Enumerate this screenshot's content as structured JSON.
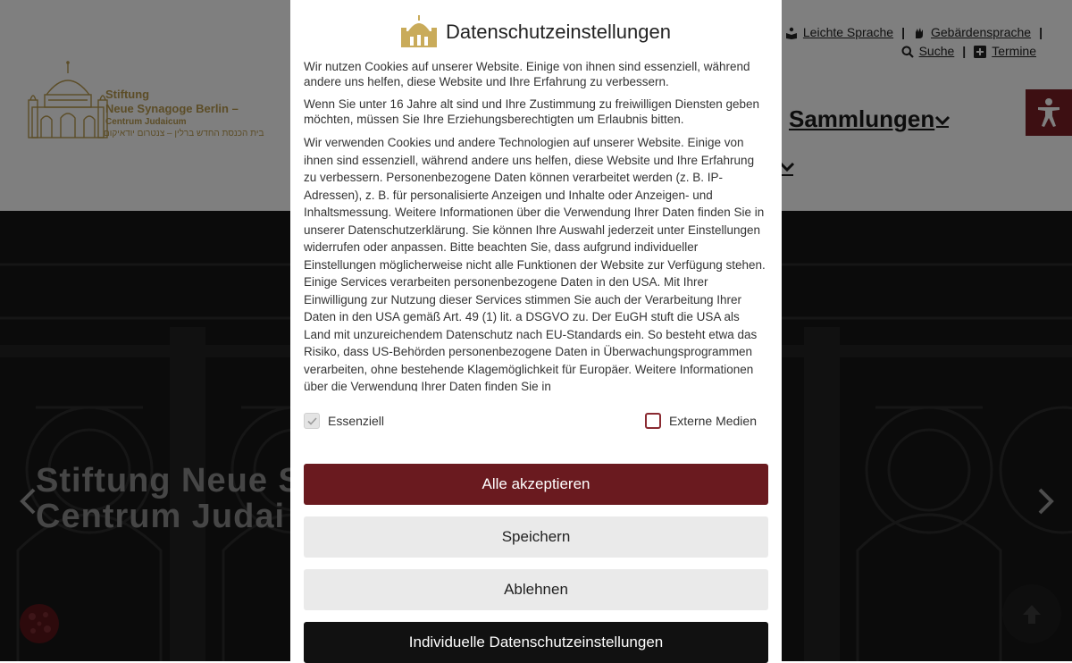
{
  "header": {
    "logo": {
      "line1": "Stiftung",
      "line2": "Neue Synagoge Berlin –",
      "line3": "Centrum Judaicum",
      "line4": "בית הכנסת החדש ברלין – צנטרום יודאיקום"
    },
    "topnav": {
      "row1": [
        "Leichte Sprache",
        "Gebärdensprache"
      ],
      "row2": [
        "Suche",
        "Termine"
      ]
    },
    "mainnav": {
      "item": "Sammlungen"
    }
  },
  "hero": {
    "title_line1": "Stiftung Neue S",
    "title_line2": "Centrum Judai"
  },
  "modal": {
    "title": "Datenschutzeinstellungen",
    "paragraphs": [
      "Wir nutzen Cookies auf unserer Website. Einige von ihnen sind essenziell, während andere uns helfen, diese Website und Ihre Erfahrung zu verbessern.",
      "Wenn Sie unter 16 Jahre alt sind und Ihre Zustimmung zu freiwilligen Diensten geben möchten, müssen Sie Ihre Erziehungsberechtigten um Erlaubnis bitten.",
      "Wir verwenden Cookies und andere Technologien auf unserer Website. Einige von ihnen sind essenziell, während andere uns helfen, diese Website und Ihre Erfahrung zu verbessern. Personenbezogene Daten können verarbeitet werden (z. B. IP-Adressen), z. B. für personalisierte Anzeigen und Inhalte oder Anzeigen- und Inhaltsmessung. Weitere Informationen über die Verwendung Ihrer Daten finden Sie in unserer Datenschutzerklärung. Sie können Ihre Auswahl jederzeit unter Einstellungen widerrufen oder anpassen. Bitte beachten Sie, dass aufgrund individueller Einstellungen möglicherweise nicht alle Funktionen der Website zur Verfügung stehen. Einige Services verarbeiten personenbezogene Daten in den USA. Mit Ihrer Einwilligung zur Nutzung dieser Services stimmen Sie auch der Verarbeitung Ihrer Daten in den USA gemäß Art. 49 (1) lit. a DSGVO zu. Der EuGH stuft die USA als Land mit unzureichendem Datenschutz nach EU-Standards ein. So besteht etwa das Risiko, dass US-Behörden personenbezogene Daten in Überwachungsprogrammen verarbeiten, ohne bestehende Klagemöglichkeit für Europäer. Weitere Informationen über die Verwendung Ihrer Daten finden Sie in"
    ],
    "checks": {
      "essential": {
        "label": "Essenziell",
        "checked": true
      },
      "external": {
        "label": "Externe Medien",
        "checked": false
      }
    },
    "buttons": {
      "accept_all": "Alle akzeptieren",
      "save": "Speichern",
      "reject": "Ablehnen",
      "individual": "Individuelle Datenschutzeinstellungen"
    }
  },
  "colors": {
    "brand_red": "#6a1a1f",
    "gold": "#b99a4e",
    "dark_button": "#111111",
    "light_button": "#eaeaea"
  },
  "icons": [
    "synagogue-logo-icon",
    "book-reading-icon",
    "sign-language-icon",
    "search-icon",
    "plus-square-icon",
    "chevron-down-icon",
    "accessibility-icon",
    "chevron-left-icon",
    "chevron-right-icon",
    "arrow-up-icon",
    "cookie-icon",
    "checkmark-icon"
  ]
}
